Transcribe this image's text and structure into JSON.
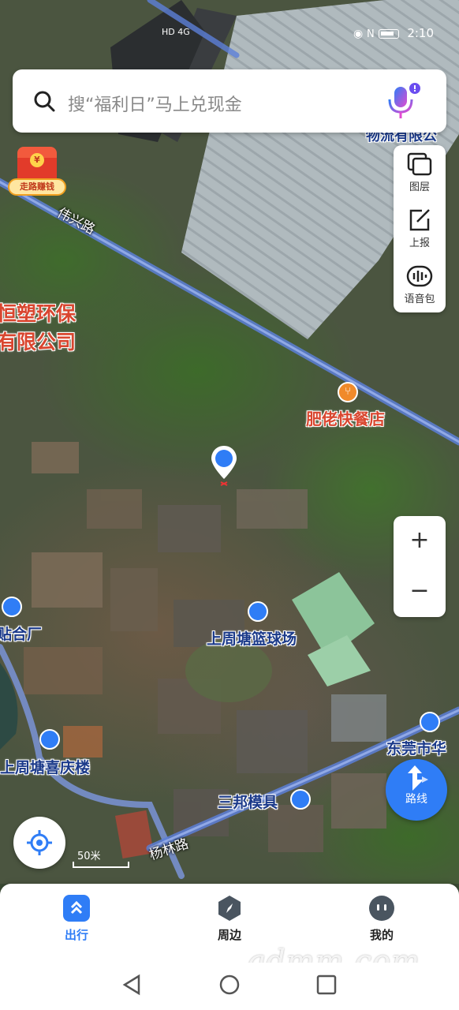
{
  "status_bar": {
    "network": "HD 4G",
    "time": "2:10"
  },
  "search": {
    "placeholder": "搜“福利日”马上兑现金"
  },
  "promo": {
    "coin": "¥",
    "label": "走路赚钱"
  },
  "tools": [
    {
      "icon": "layers-icon",
      "label": "图层"
    },
    {
      "icon": "report-icon",
      "label": "上报"
    },
    {
      "icon": "voice-pack-icon",
      "label": "语音包"
    }
  ],
  "zoom": {
    "in": "+",
    "out": "−"
  },
  "route_button": {
    "label": "路线"
  },
  "scale": {
    "label": "50米"
  },
  "map": {
    "roads": [
      {
        "name": "伟兴路"
      },
      {
        "name": "杨林路"
      }
    ],
    "places": [
      {
        "name": "恒塑环保",
        "color": "#d9462f"
      },
      {
        "name": "有限公司",
        "color": "#d9462f"
      },
      {
        "name": "肥佬快餐店",
        "color": "#d9462f"
      },
      {
        "name": "上周塘篮球场",
        "color": "#1b3a8a"
      },
      {
        "name": "贴合厂",
        "color": "#1b3a8a"
      },
      {
        "name": "上周塘喜庆楼",
        "color": "#1b3a8a"
      },
      {
        "name": "三邦模具",
        "color": "#1b3a8a"
      },
      {
        "name": "东莞市华",
        "color": "#1b3a8a"
      },
      {
        "name": "物流有限公",
        "color": "#1b3a8a"
      }
    ]
  },
  "bottom_nav": [
    {
      "label": "出行",
      "active": true
    },
    {
      "label": "周边",
      "active": false
    },
    {
      "label": "我的",
      "active": false
    }
  ],
  "watermark": "gdmm.com",
  "colors": {
    "accent": "#2f7df6",
    "poi_blue": "#2f7df6",
    "food_orange": "#f08a2a"
  }
}
